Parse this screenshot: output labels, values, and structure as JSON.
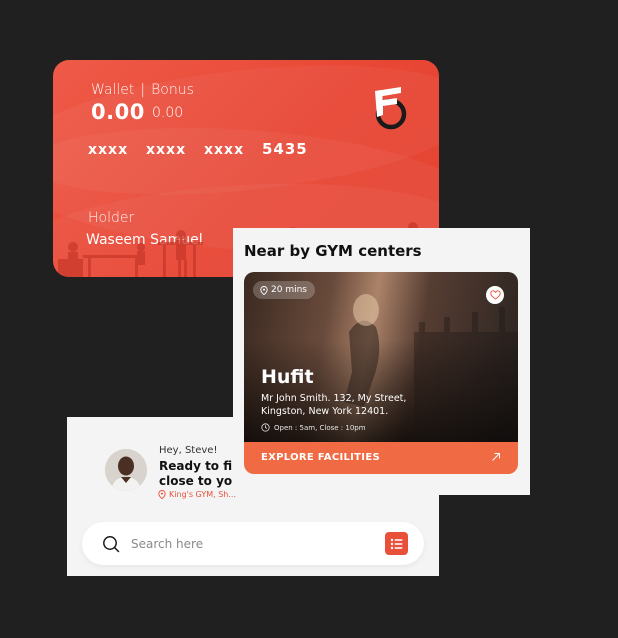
{
  "wallet": {
    "wallet_label": "Wallet",
    "separator": "|",
    "bonus_label": "Bonus",
    "balance": "0.00",
    "bonus_amount": "0.00",
    "card_number": [
      "xxxx",
      "xxxx",
      "xxxx",
      "5435"
    ],
    "holder_label": "Holder",
    "holder_name": "Waseem Samuel",
    "brand_color": "#e84735"
  },
  "nearby": {
    "title": "Near by GYM centers",
    "gym": {
      "travel_time": "20 mins",
      "name": "Hufit",
      "address": "Mr John Smith. 132, My Street, Kingston, New York 12401.",
      "hours": "Open : 5am, Close : 10pm",
      "cta": "EXPLORE FACILITIES",
      "cta_color": "#f06a43"
    }
  },
  "home": {
    "greeting": "Hey, Steve!",
    "headline": "Ready to find a gym close to you",
    "location": "King's GYM, Sh...",
    "search_placeholder": "Search here",
    "accent_color": "#e8503a"
  }
}
